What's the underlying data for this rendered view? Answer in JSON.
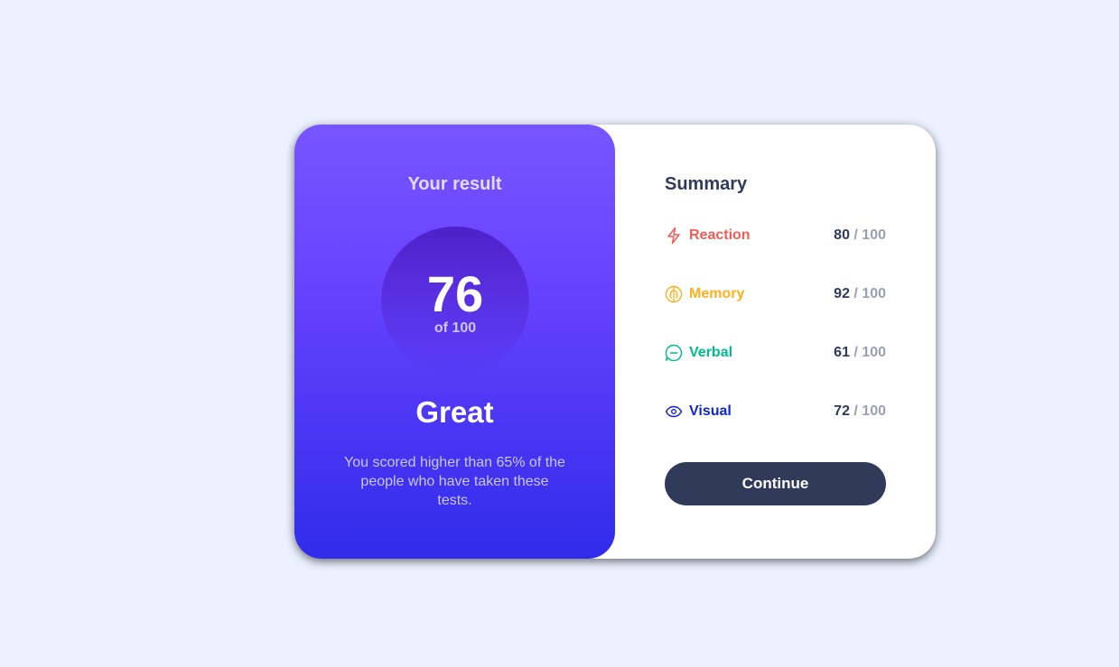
{
  "result": {
    "title": "Your result",
    "score": "76",
    "of": "of 100",
    "grade": "Great",
    "description": "You scored higher than 65% of the people who have taken these tests."
  },
  "summary": {
    "title": "Summary",
    "items": [
      {
        "label": "Reaction",
        "score": "80",
        "max": " / 100",
        "color": "#f25c54",
        "icon": "lightning-icon"
      },
      {
        "label": "Memory",
        "score": "92",
        "max": " / 100",
        "color": "#ffb01f",
        "icon": "brain-icon"
      },
      {
        "label": "Verbal",
        "score": "61",
        "max": " / 100",
        "color": "#00bb8f",
        "icon": "chat-bubble-icon"
      },
      {
        "label": "Visual",
        "score": "72",
        "max": " / 100",
        "color": "#1125d6",
        "icon": "eye-icon"
      }
    ],
    "continue_label": "Continue"
  },
  "colors": {
    "background": "#ebf1ff",
    "gradient_top": "#7755ff",
    "gradient_bottom": "#2f2cea",
    "dark": "#303b5a"
  }
}
